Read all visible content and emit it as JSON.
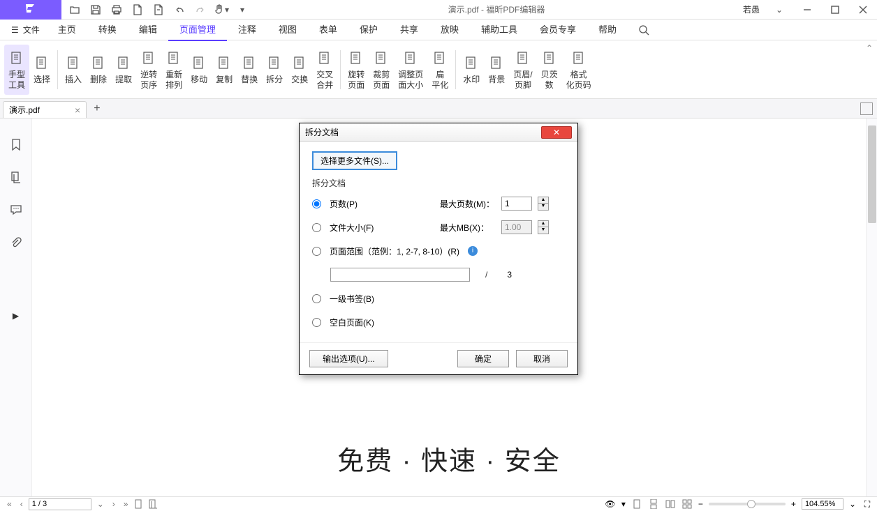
{
  "titlebar": {
    "doc": "演示.pdf",
    "app": "福昕PDF编辑器",
    "user": "若愚"
  },
  "menubar": {
    "file": "文件",
    "items": [
      "主页",
      "转换",
      "编辑",
      "页面管理",
      "注释",
      "视图",
      "表单",
      "保护",
      "共享",
      "放映",
      "辅助工具",
      "会员专享",
      "帮助"
    ],
    "active_index": 3
  },
  "ribbon": {
    "items": [
      {
        "l1": "手型",
        "l2": "工具"
      },
      {
        "l1": "选择"
      },
      {
        "l1": "插入"
      },
      {
        "l1": "删除"
      },
      {
        "l1": "提取"
      },
      {
        "l1": "逆转",
        "l2": "页序"
      },
      {
        "l1": "重新",
        "l2": "排列"
      },
      {
        "l1": "移动"
      },
      {
        "l1": "复制"
      },
      {
        "l1": "替换"
      },
      {
        "l1": "拆分"
      },
      {
        "l1": "交换"
      },
      {
        "l1": "交叉",
        "l2": "合并"
      },
      {
        "l1": "旋转",
        "l2": "页面"
      },
      {
        "l1": "裁剪",
        "l2": "页面"
      },
      {
        "l1": "调整页",
        "l2": "面大小"
      },
      {
        "l1": "扁",
        "l2": "平化"
      },
      {
        "l1": "水印"
      },
      {
        "l1": "背景"
      },
      {
        "l1": "页眉/",
        "l2": "页脚"
      },
      {
        "l1": "贝茨",
        "l2": "数"
      },
      {
        "l1": "格式",
        "l2": "化页码"
      }
    ]
  },
  "tabs": {
    "doc": "演示.pdf"
  },
  "hero": "免费 · 快速 · 安全",
  "statusbar": {
    "page": "1 / 3",
    "zoom": "104.55%"
  },
  "dialog": {
    "title": "拆分文档",
    "select_more": "选择更多文件(S)...",
    "section": "拆分文档",
    "opt_pages": "页数(P)",
    "lbl_max_pages": "最大页数(M)：",
    "val_max_pages": "1",
    "opt_size": "文件大小(F)",
    "lbl_max_mb": "最大MB(X)：",
    "val_max_mb": "1.00",
    "opt_range": "页面范围（范例：1, 2-7, 8-10）(R)",
    "range_total": "3",
    "opt_bookmark": "一级书签(B)",
    "opt_blank": "空白页面(K)",
    "btn_output": "输出选项(U)...",
    "btn_ok": "确定",
    "btn_cancel": "取消"
  }
}
